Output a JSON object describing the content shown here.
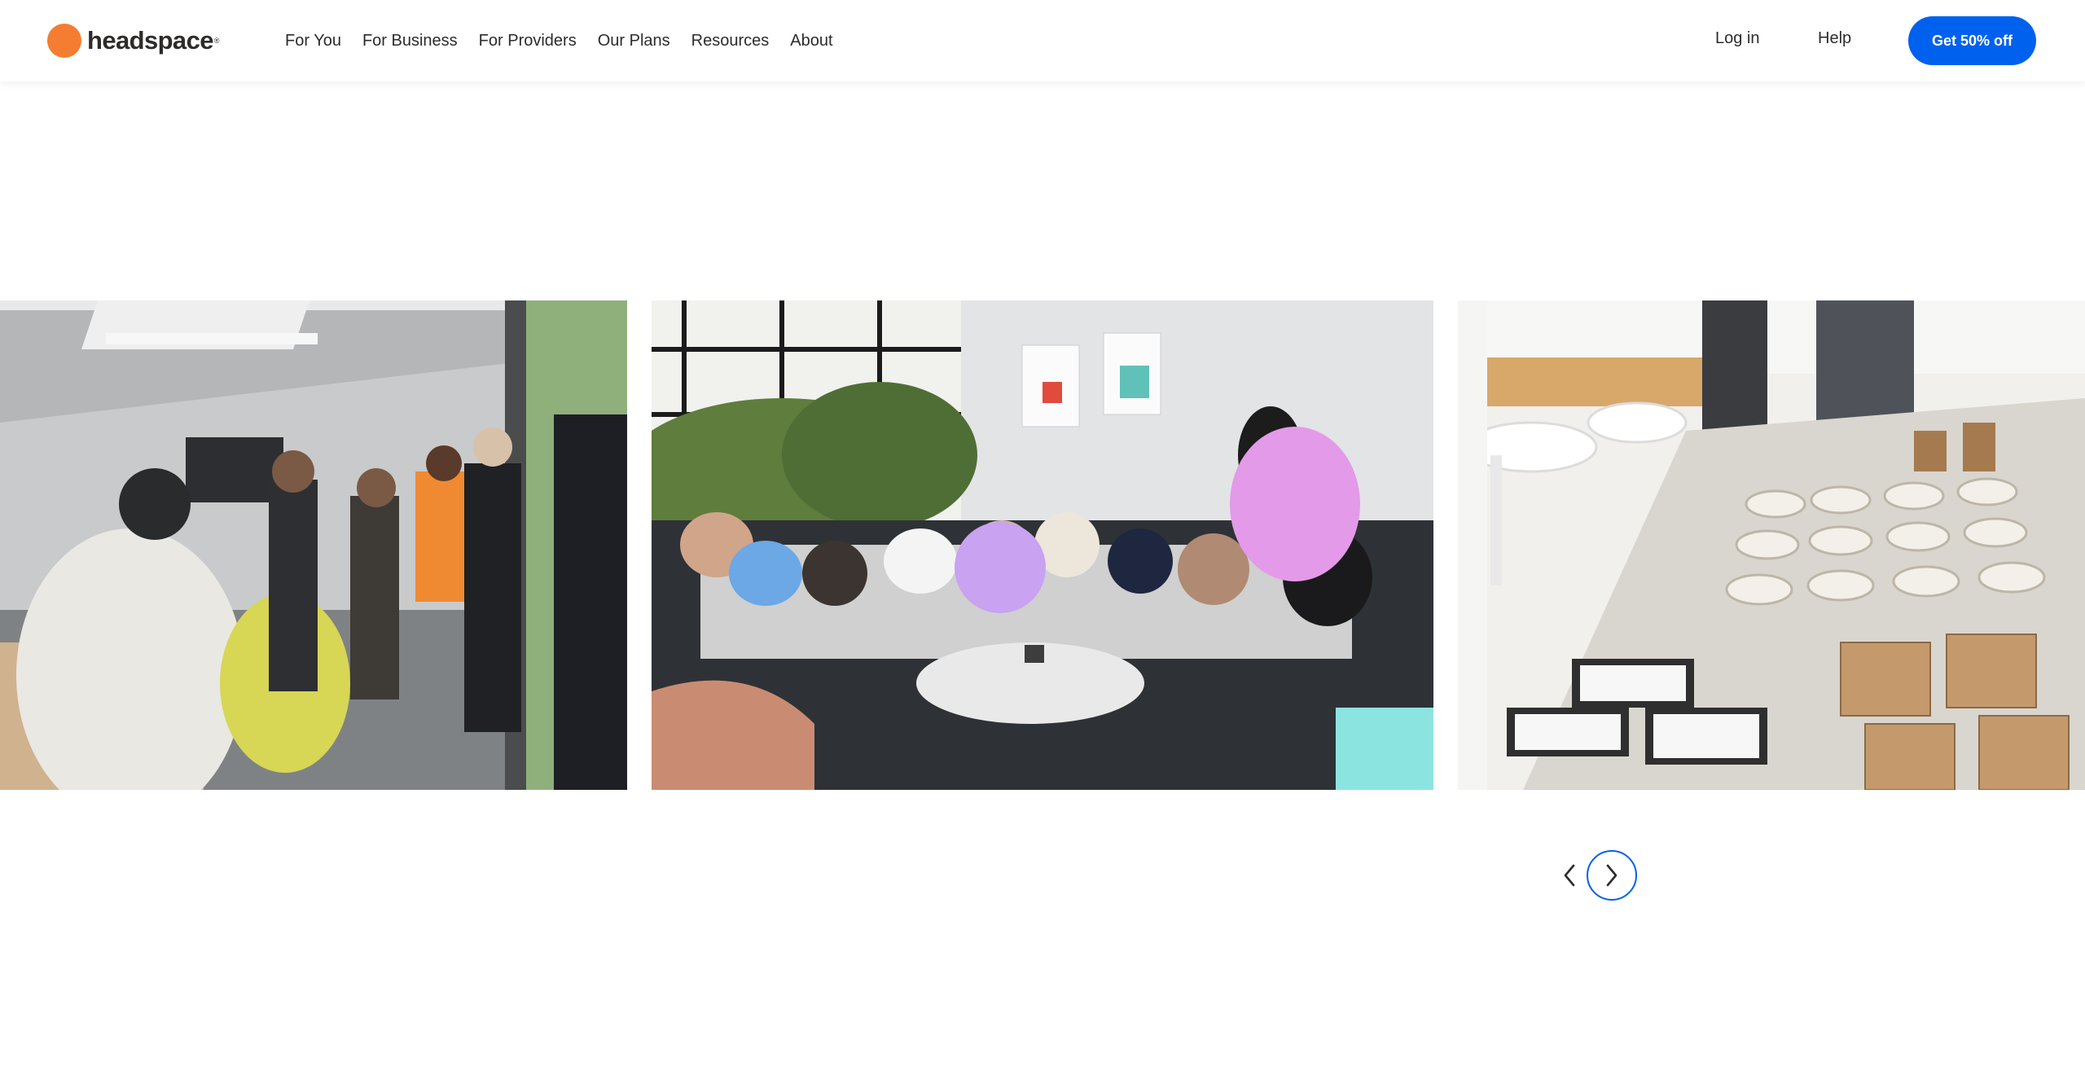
{
  "header": {
    "logo": {
      "wordmark": "headspace",
      "trademark": "®",
      "icon": "orange-circle-icon",
      "color": "#f47d31"
    },
    "nav": [
      {
        "label": "For You"
      },
      {
        "label": "For Business"
      },
      {
        "label": "For Providers"
      },
      {
        "label": "Our Plans"
      },
      {
        "label": "Resources"
      },
      {
        "label": "About"
      }
    ],
    "login_label": "Log in",
    "help_label": "Help",
    "cta_label": "Get 50% off",
    "cta_color": "#0061ef"
  },
  "gallery": {
    "photos": [
      {
        "subject": "team-standing-in-office-photo"
      },
      {
        "subject": "team-seated-on-sofa-photo"
      },
      {
        "subject": "catered-food-table-photo"
      }
    ]
  },
  "carousel": {
    "prev_icon": "chevron-left-icon",
    "next_icon": "chevron-right-icon",
    "accent_color": "#0061ef"
  }
}
